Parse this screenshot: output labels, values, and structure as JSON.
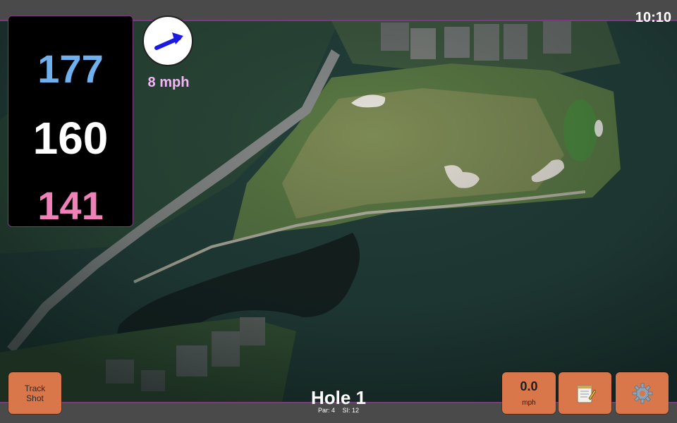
{
  "status": {
    "time": "10:10"
  },
  "distances": {
    "back": "177",
    "middle": "160",
    "front": "141"
  },
  "wind": {
    "speed": "8 mph",
    "icon": "wind-direction-arrow-icon"
  },
  "hole": {
    "title": "Hole 1",
    "par": "Par: 4",
    "si": "SI: 12"
  },
  "buttons": {
    "track_shot": "Track\nShot",
    "speed_value": "0.0",
    "speed_unit": "mph",
    "notes_icon": "notepad-icon",
    "settings_icon": "gear-icon"
  },
  "colors": {
    "back_distance": "#6fb1ef",
    "middle_distance": "#ffffff",
    "front_distance": "#f080b8",
    "button": "#d9764a",
    "accent": "#7b3a80"
  }
}
